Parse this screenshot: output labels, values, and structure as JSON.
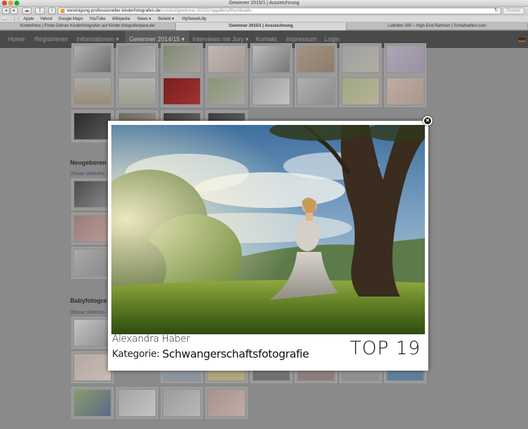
{
  "browser": {
    "window_title": "Gewinner 2015/1 | Auszeichnung",
    "url_host": "vereinigung-professioneller-kinderfotografen.de",
    "url_path": "/contest/gewinner-20151/nggallery/thumbnails",
    "reader_label": "Reader",
    "reload_glyph": "↻",
    "bookmarks": [
      "Apple",
      "Yahoo!",
      "Google Maps",
      "YouTube",
      "Wikipedia",
      "News ▾",
      "Beliebt ▾",
      "MySweetLilly"
    ],
    "tabs": [
      {
        "label": "Kinderfotos | Finde Deinen Kinderfotografen auf Kinder.fotografenpara.de!",
        "active": false
      },
      {
        "label": "Gewinner 2015/1 | Auszeichnung",
        "active": true
      },
      {
        "label": "Lattoflex 300 – High-End-Rahmen | Schlafwelten.com",
        "active": false
      }
    ]
  },
  "site": {
    "nav": [
      {
        "label": "Home"
      },
      {
        "label": "Registrieren"
      },
      {
        "label": "Informationen ▾"
      },
      {
        "label": "Gewinner 2014/15 ▾"
      },
      {
        "label": "Interviews mit Jury ▾"
      },
      {
        "label": "Kontakt"
      },
      {
        "label": "Impressum"
      },
      {
        "label": "Login"
      }
    ],
    "sections": [
      {
        "title": "Neugeboren",
        "link": "[Show slidesho"
      },
      {
        "title": "Babyfotogra",
        "link": "[Show slidesho"
      }
    ]
  },
  "lightbox": {
    "name": "Alexandra Haber",
    "category_label": "Kategorie:",
    "category": "Schwangerschaftsfotografie",
    "rank": "TOP 19",
    "close_glyph": "✕"
  }
}
